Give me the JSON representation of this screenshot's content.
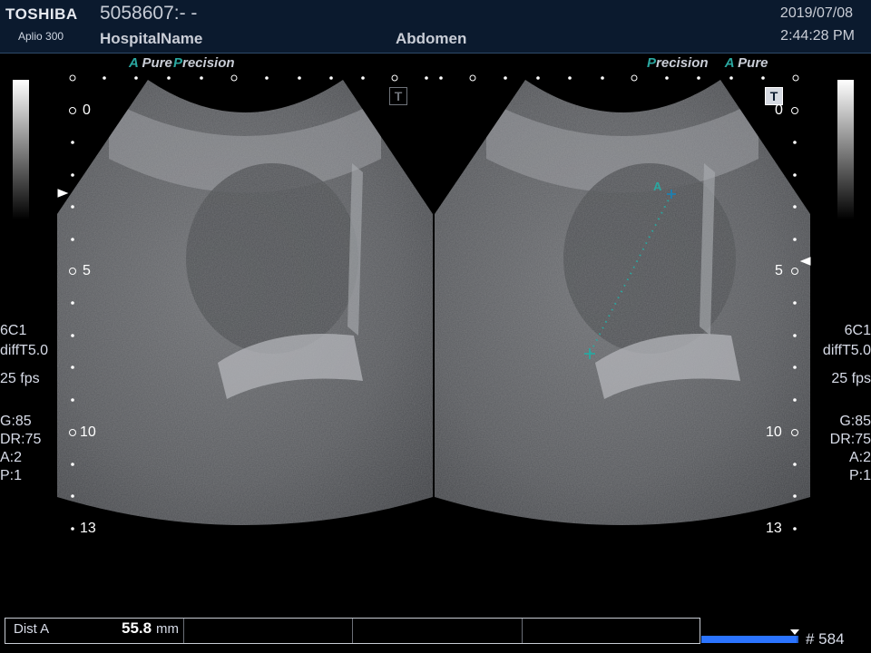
{
  "header": {
    "brand": "TOSHIBA",
    "model": "Aplio 300",
    "patient_id": "5058607:- -",
    "hospital": "HospitalName",
    "exam": "Abdomen",
    "date": "2019/07/08",
    "time": "2:44:28 PM"
  },
  "left_image": {
    "mode_a": "A",
    "mode_pure": "Pure",
    "mode_p": "P",
    "mode_precision": "recision",
    "t_marker": "T"
  },
  "right_image": {
    "mode_p": "P",
    "mode_precision": "recision",
    "mode_a": "A",
    "mode_pure": "Pure",
    "t_marker": "T",
    "caliper_label": "A"
  },
  "depth_scale": {
    "d0": "0",
    "d5": "5",
    "d10": "10",
    "d13": "13"
  },
  "params": {
    "transducer": "6C1",
    "preset": "diffT5.0",
    "fps": "25 fps",
    "gain": "G:85",
    "dr": "DR:75",
    "a": "A:2",
    "p": "P:1"
  },
  "measurement": {
    "label": "Dist A",
    "value": "55.8",
    "unit": "mm"
  },
  "cine": {
    "frame": "# 584",
    "progress": 0.98
  },
  "colors": {
    "header_bg": "#0b1a2e",
    "caliper": "#2aa7a0",
    "cine_bar": "#2b74ff"
  }
}
